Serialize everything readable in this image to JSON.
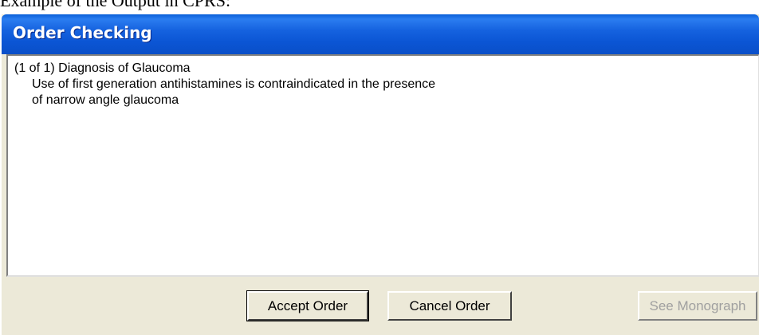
{
  "caption": "Example of the Output in CPRS:",
  "window": {
    "title": "Order Checking"
  },
  "message": {
    "header": "(1 of 1)  Diagnosis of Glaucoma",
    "lines": [
      "Use of first generation antihistamines is contraindicated in the presence",
      "of narrow angle glaucoma"
    ]
  },
  "buttons": {
    "accept": "Accept Order",
    "cancel": "Cancel Order",
    "monograph": "See Monograph"
  }
}
